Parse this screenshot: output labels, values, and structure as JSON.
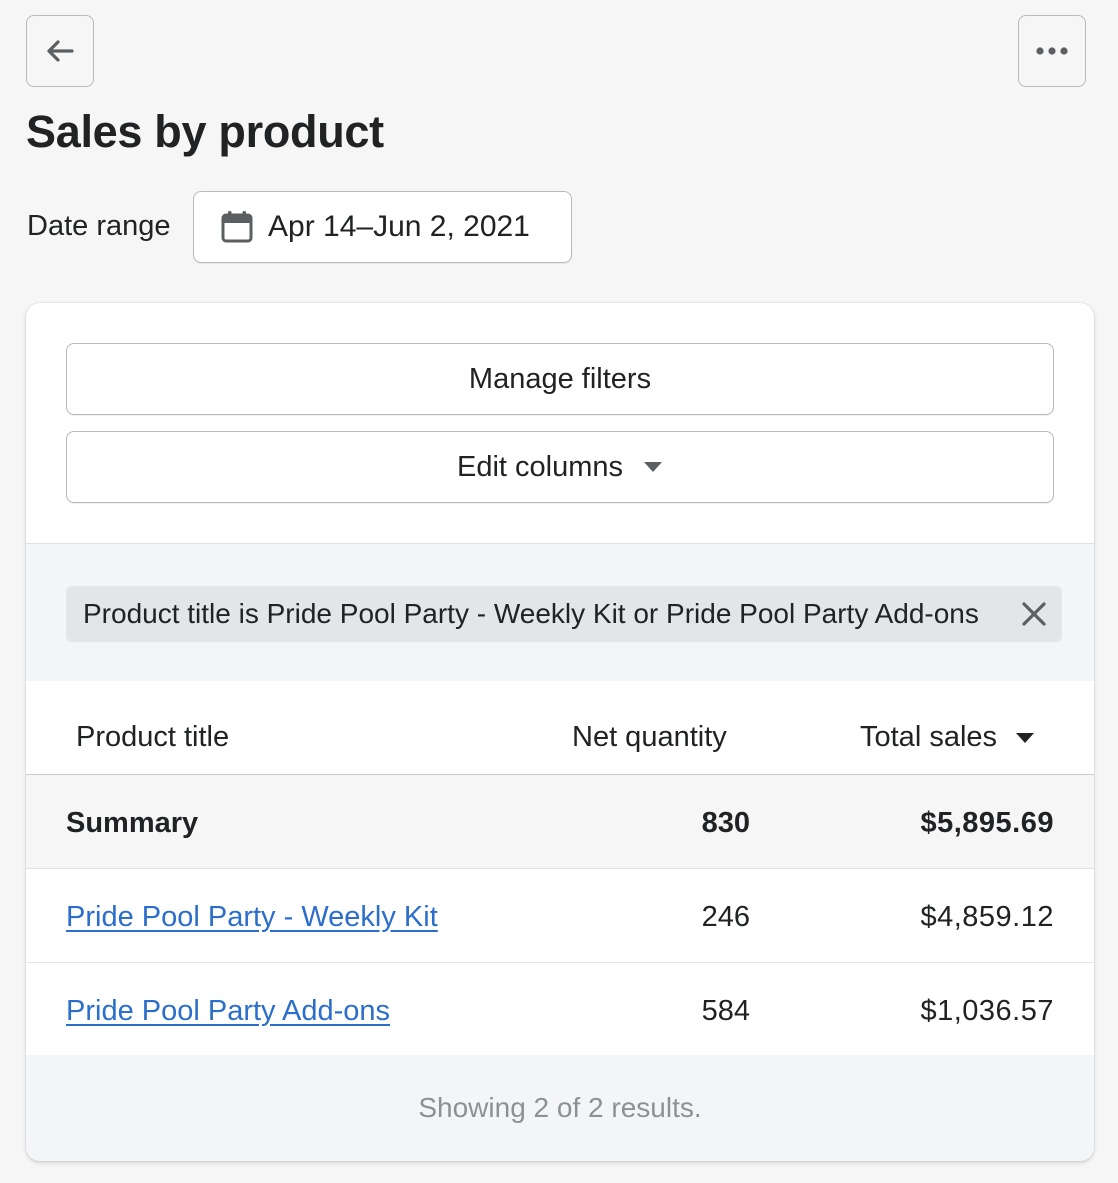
{
  "header": {
    "title": "Sales by product",
    "back_icon": "arrow-left-icon",
    "more_icon": "horizontal-dots-icon"
  },
  "date_range": {
    "label": "Date range",
    "value": "Apr 14–Jun 2, 2021",
    "icon": "calendar-icon"
  },
  "toolbar": {
    "manage_filters_label": "Manage filters",
    "edit_columns_label": "Edit columns"
  },
  "filter_chip": {
    "text": "Product title is Pride Pool Party - Weekly Kit or Pride Pool Party Add-ons",
    "close_icon": "close-icon"
  },
  "table": {
    "columns": [
      "Product title",
      "Net quantity",
      "Total sales"
    ],
    "sorted_column": "Total sales",
    "summary": {
      "label": "Summary",
      "net_quantity": "830",
      "total_sales": "$5,895.69"
    },
    "rows": [
      {
        "product_title": "Pride Pool Party - Weekly Kit",
        "net_quantity": "246",
        "total_sales": "$4,859.12"
      },
      {
        "product_title": "Pride Pool Party Add-ons",
        "net_quantity": "584",
        "total_sales": "$1,036.57"
      }
    ],
    "footer": "Showing 2 of 2 results."
  },
  "colors": {
    "background": "#f6f6f7",
    "link": "#2c6ecb",
    "text": "#202223",
    "muted": "#8c9196"
  }
}
